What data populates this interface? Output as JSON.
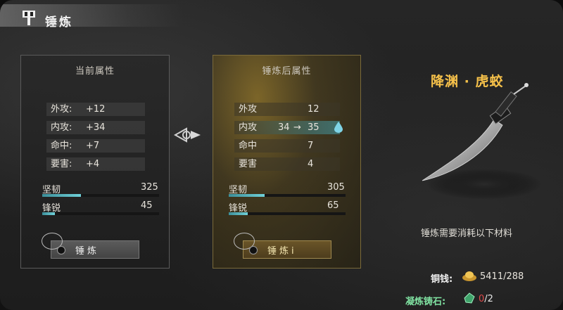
{
  "header": {
    "title": "锤炼",
    "icon": "hammer-banner-icon"
  },
  "current_panel": {
    "title": "当前属性",
    "stats": [
      {
        "label": "外攻:",
        "value": "+12"
      },
      {
        "label": "内攻:",
        "value": "+34"
      },
      {
        "label": "命中:",
        "value": "+7"
      },
      {
        "label": "要害:",
        "value": "+4"
      }
    ],
    "bars": [
      {
        "label": "坚韧",
        "value": "325",
        "fill": 0.33
      },
      {
        "label": "锋锐",
        "value": "45",
        "fill": 0.11
      }
    ],
    "button_label": "锤炼"
  },
  "after_panel": {
    "title": "锤炼后属性",
    "stats": [
      {
        "label": "外攻",
        "value": "12"
      },
      {
        "label": "内攻",
        "value": "",
        "from": "34",
        "to": "35"
      },
      {
        "label": "命中",
        "value": "7"
      },
      {
        "label": "要害",
        "value": "4"
      }
    ],
    "bars": [
      {
        "label": "坚韧",
        "value": "305",
        "fill": 0.31
      },
      {
        "label": "锋锐",
        "value": "65",
        "fill": 0.16
      }
    ],
    "button_label": "锤炼i"
  },
  "weapon": {
    "name": "降渊 · 虎蛟",
    "material_note": "锤炼需要消耗以下材料",
    "copper_label": "铜钱:",
    "copper_value": "5411/288",
    "stone_label": "凝炼铸石:",
    "stone_have": "0",
    "stone_need": "/2"
  },
  "colors": {
    "accent_gold": "#f6c14a",
    "bar_teal": "#6fd0d8",
    "stone_green": "#7fe0a0",
    "deficit_red": "#e04a4a"
  }
}
